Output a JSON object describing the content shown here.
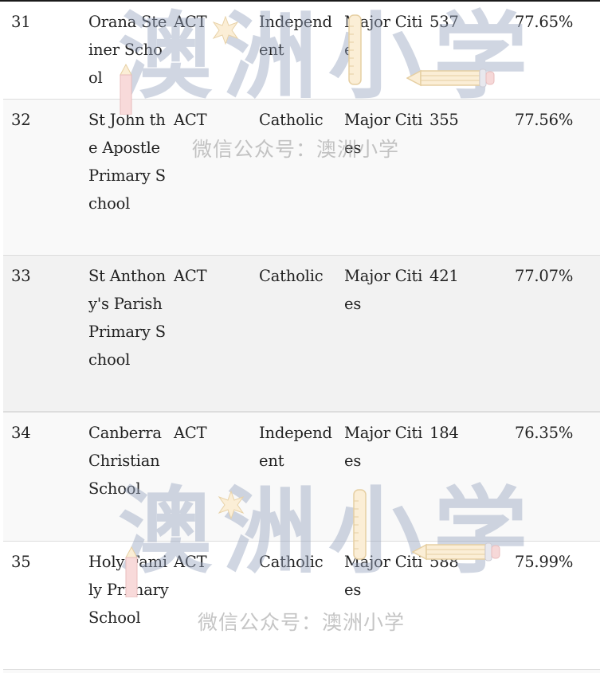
{
  "table": {
    "rows": [
      {
        "rank": "31",
        "school": "Orana Steiner School",
        "state": "ACT",
        "sector": "Independent",
        "location": "Major Cities",
        "enrolment": "537",
        "score": "77.65%"
      },
      {
        "rank": "32",
        "school": "St John the Apostle Primary School",
        "state": "ACT",
        "sector": "Catholic",
        "location": "Major Cities",
        "enrolment": "355",
        "score": "77.56%"
      },
      {
        "rank": "33",
        "school": "St Anthony's Parish Primary School",
        "state": "ACT",
        "sector": "Catholic",
        "location": "Major Cities",
        "enrolment": "421",
        "score": "77.07%"
      },
      {
        "rank": "34",
        "school": "Canberra Christian School",
        "state": "ACT",
        "sector": "Independent",
        "location": "Major Cities",
        "enrolment": "184",
        "score": "76.35%"
      },
      {
        "rank": "35",
        "school": "Holy Family Primary School",
        "state": "ACT",
        "sector": "Catholic",
        "location": "Major Cities",
        "enrolment": "588",
        "score": "75.99%"
      }
    ]
  },
  "watermark": {
    "logo_text": "澳洲小学",
    "caption": "微信公众号：澳洲小学"
  },
  "colors": {
    "row_white": "#ffffff",
    "row_light": "#f9f9f9",
    "row_mid": "#f2f2f2",
    "text": "#222222",
    "watermark_logo": "#96a5be",
    "watermark_caption": "#969696"
  }
}
